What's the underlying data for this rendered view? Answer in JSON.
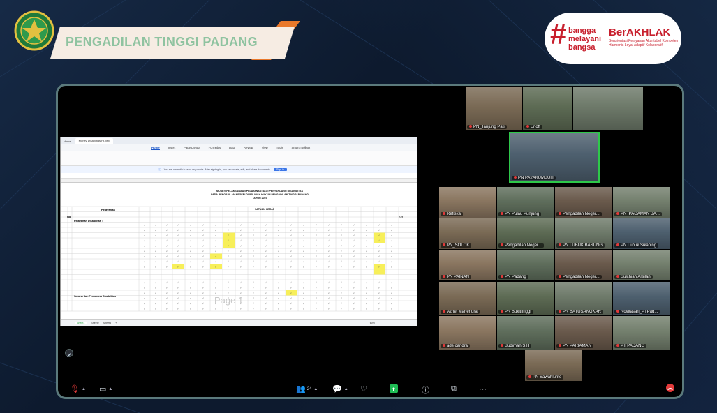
{
  "header": {
    "title": "PENGADILAN TINGGI PADANG"
  },
  "badge": {
    "line1": "bangga",
    "line2": "melayani",
    "line3": "bangsa",
    "brand": "BerAKHLAK",
    "tagline": "Berorientasi Pelayanan Akuntabel Kompeten Harmonis Loyal Adaptif Kolaboratif"
  },
  "spreadsheet": {
    "app_tab": "Home",
    "doc_tab": "Monev Disabilitas Pt.xlsx",
    "menu": [
      "Home",
      "Insert",
      "Page Layout",
      "Formulas",
      "Data",
      "Review",
      "View",
      "Tools",
      "Smart Toolbox"
    ],
    "notice": "You are currently in read-only mode. After signing in, you can create, edit, and share documents.",
    "signin_label": "Sign in",
    "doc_title_1": "MONEV PELAKSANAAN PELAYANAN BAGI PENYANDANG DISABILITAS",
    "doc_title_2": "PADA PENGADILAN NEGERI DI WILAYAH HUKUM PENGADILAN TINGGI PADANG",
    "doc_title_3": "TAHUN 2023",
    "header_no": "No",
    "header_service": "Pelayanan",
    "header_unit": "SATUAN KERJA",
    "header_ket": "Ket",
    "section_1": "Pelayanan Disabilitas :",
    "section_2": "Sarana dan Prasarana Disabilitas :",
    "watermark": "Page 1",
    "sheets": [
      "Sheet1",
      "Sheet2",
      "Sheet3"
    ],
    "zoom": "60%"
  },
  "participants": [
    {
      "name": "PN_Tanjung Pati",
      "muted": true
    },
    {
      "name": "Enoff",
      "muted": true
    },
    {
      "name": "",
      "muted": false
    },
    {
      "name": "PN PAYAKUMBUH",
      "muted": true
    },
    {
      "name": "Refiska",
      "muted": true
    },
    {
      "name": "PN Pulau Punjung",
      "muted": true
    },
    {
      "name": "Pengadilan Neger...",
      "muted": true
    },
    {
      "name": "PN_PAGAMAN BA...",
      "muted": true
    },
    {
      "name": "PN_SOLOK",
      "muted": true
    },
    {
      "name": "Pengadilan Neger...",
      "muted": true
    },
    {
      "name": "PN LUBUK BASUNG",
      "muted": true
    },
    {
      "name": "PN Lubuk Sikaping",
      "muted": true
    },
    {
      "name": "PN PAINAN",
      "muted": true
    },
    {
      "name": "PN Padang",
      "muted": true
    },
    {
      "name": "Pengadilan Neger...",
      "muted": true
    },
    {
      "name": "Sulchian Arsilan",
      "muted": true
    },
    {
      "name": "Azriel Mahendra",
      "muted": true
    },
    {
      "name": "PN Bukittinggi",
      "muted": true
    },
    {
      "name": "PN BATUSANGKAR",
      "muted": true
    },
    {
      "name": "Novitasari_PTPad...",
      "muted": true
    },
    {
      "name": "ade candra",
      "muted": true
    },
    {
      "name": "Budiman S.H",
      "muted": true
    },
    {
      "name": "PN PARIAMAN",
      "muted": true
    },
    {
      "name": "PT PADANG",
      "muted": true
    },
    {
      "name": "PN Sawahlunto",
      "muted": true
    }
  ],
  "toolbar": {
    "participant_count": "24"
  },
  "colors": {
    "accent_orange": "#e9782a",
    "banner_text": "#8fc3a0",
    "brand_red": "#c81f2d",
    "share_green": "#1fbd55"
  }
}
